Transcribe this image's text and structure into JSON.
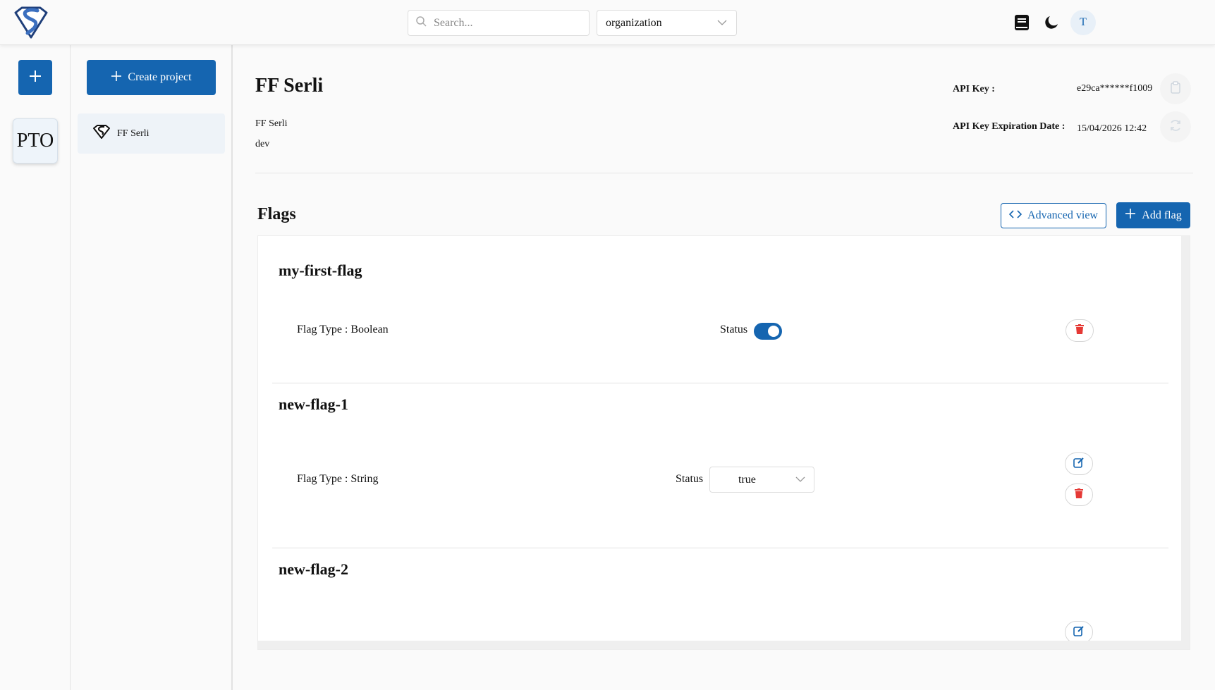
{
  "header": {
    "search_placeholder": "Search...",
    "org_select_value": "organization",
    "avatar_initial": "T",
    "icons": [
      "book-icon",
      "moon-icon"
    ]
  },
  "rail": {
    "org_label": "PTO"
  },
  "sidebar": {
    "create_project_label": "Create project",
    "projects": [
      {
        "label": "FF Serli"
      }
    ]
  },
  "project": {
    "title": "FF Serli",
    "name": "FF Serli",
    "environment": "dev",
    "api_key_label": "API Key :",
    "api_key_value": "e29ca******f1009",
    "api_key_expiration_label": "API Key Expiration Date :",
    "api_key_expiration_value": "15/04/2026 12:42"
  },
  "flags_section": {
    "title": "Flags",
    "advanced_view_label": "Advanced view",
    "add_flag_label": "Add flag",
    "status_label": "Status",
    "flags": [
      {
        "name": "my-first-flag",
        "type_text": "Flag Type : Boolean",
        "status_enabled": true
      },
      {
        "name": "new-flag-1",
        "type_text": "Flag Type : String",
        "status_value": "true"
      },
      {
        "name": "new-flag-2"
      }
    ]
  },
  "colors": {
    "primary": "#1565b0",
    "danger": "#e53935",
    "background": "#fafafa"
  }
}
